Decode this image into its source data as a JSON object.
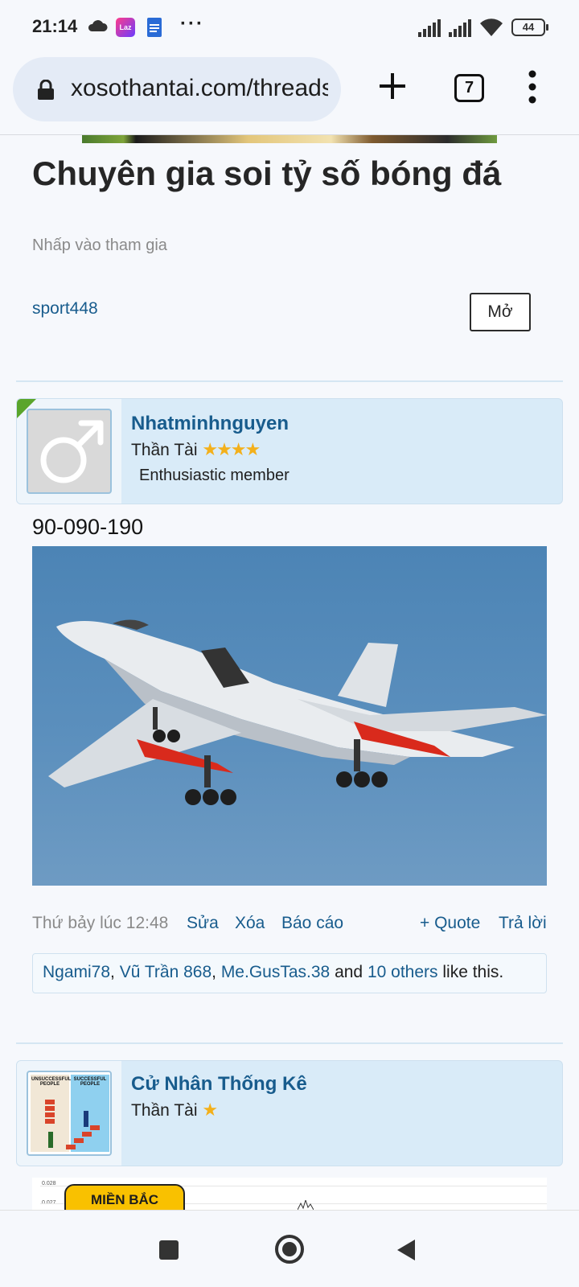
{
  "status_bar": {
    "time": "21:14",
    "icons": [
      "cloud-icon",
      "lazada-app-icon",
      "docs-app-icon",
      "more-notifications-icon",
      "signal-icon",
      "signal-icon",
      "wifi-icon"
    ],
    "more": "···",
    "battery": "44"
  },
  "browser": {
    "url": "xosothantai.com/threads",
    "tab_count": "7"
  },
  "thread": {
    "title": "Chuyên gia soi tỷ số bóng đá",
    "join_hint": "Nhấp vào tham gia",
    "tag": "sport448",
    "open_button": "Mở"
  },
  "posts": [
    {
      "username": "Nhatminhnguyen",
      "title": "Thần Tài",
      "stars": "★★★★",
      "rank": "Enthusiastic member",
      "text": "90-090-190",
      "image": "bomber-aircraft-photo",
      "date": "Thứ bảy lúc 12:48",
      "actions": {
        "edit": "Sửa",
        "delete": "Xóa",
        "report": "Báo cáo",
        "quote": "+ Quote",
        "reply": "Trả lời"
      },
      "likes": {
        "user1": "Ngami78",
        "user2": "Vũ Trần 868",
        "user3": "Me.GusTas.38",
        "and": "and",
        "others": "10 others",
        "suffix": "like this."
      }
    },
    {
      "username": "Cử Nhân Thống Kê",
      "title": "Thần Tài",
      "stars": "★",
      "avatar_text_left": "UNSUCCESSFUL PEOPLE",
      "avatar_text_right": "SUCCESSFUL PEOPLE",
      "chart_badge": "MIỀN BẮC",
      "chart_ticks": [
        "0.028",
        "0.027"
      ]
    }
  ]
}
